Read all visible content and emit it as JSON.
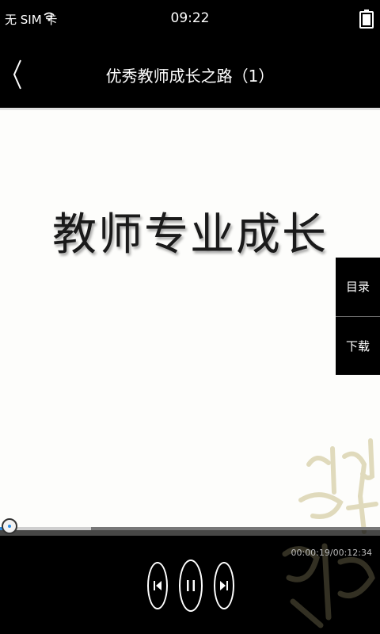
{
  "status_bar": {
    "carrier": "无 SIM 卡",
    "time": "09:22",
    "icons": [
      "wifi-icon",
      "battery-icon"
    ]
  },
  "header": {
    "title": "优秀教师成长之路（1）",
    "back_icon": "chevron-left-icon"
  },
  "slide": {
    "heading": "教师专业成长"
  },
  "side_menu": {
    "items": [
      {
        "label": "目录"
      },
      {
        "label": "下载"
      }
    ]
  },
  "player": {
    "elapsed_time": "00:00:19/00:12:34",
    "progress_fraction": 0.025,
    "buffered_fraction": 0.24,
    "accent_color": "#2d8ee6",
    "controls": [
      "previous-icon",
      "pause-icon",
      "next-icon"
    ]
  }
}
